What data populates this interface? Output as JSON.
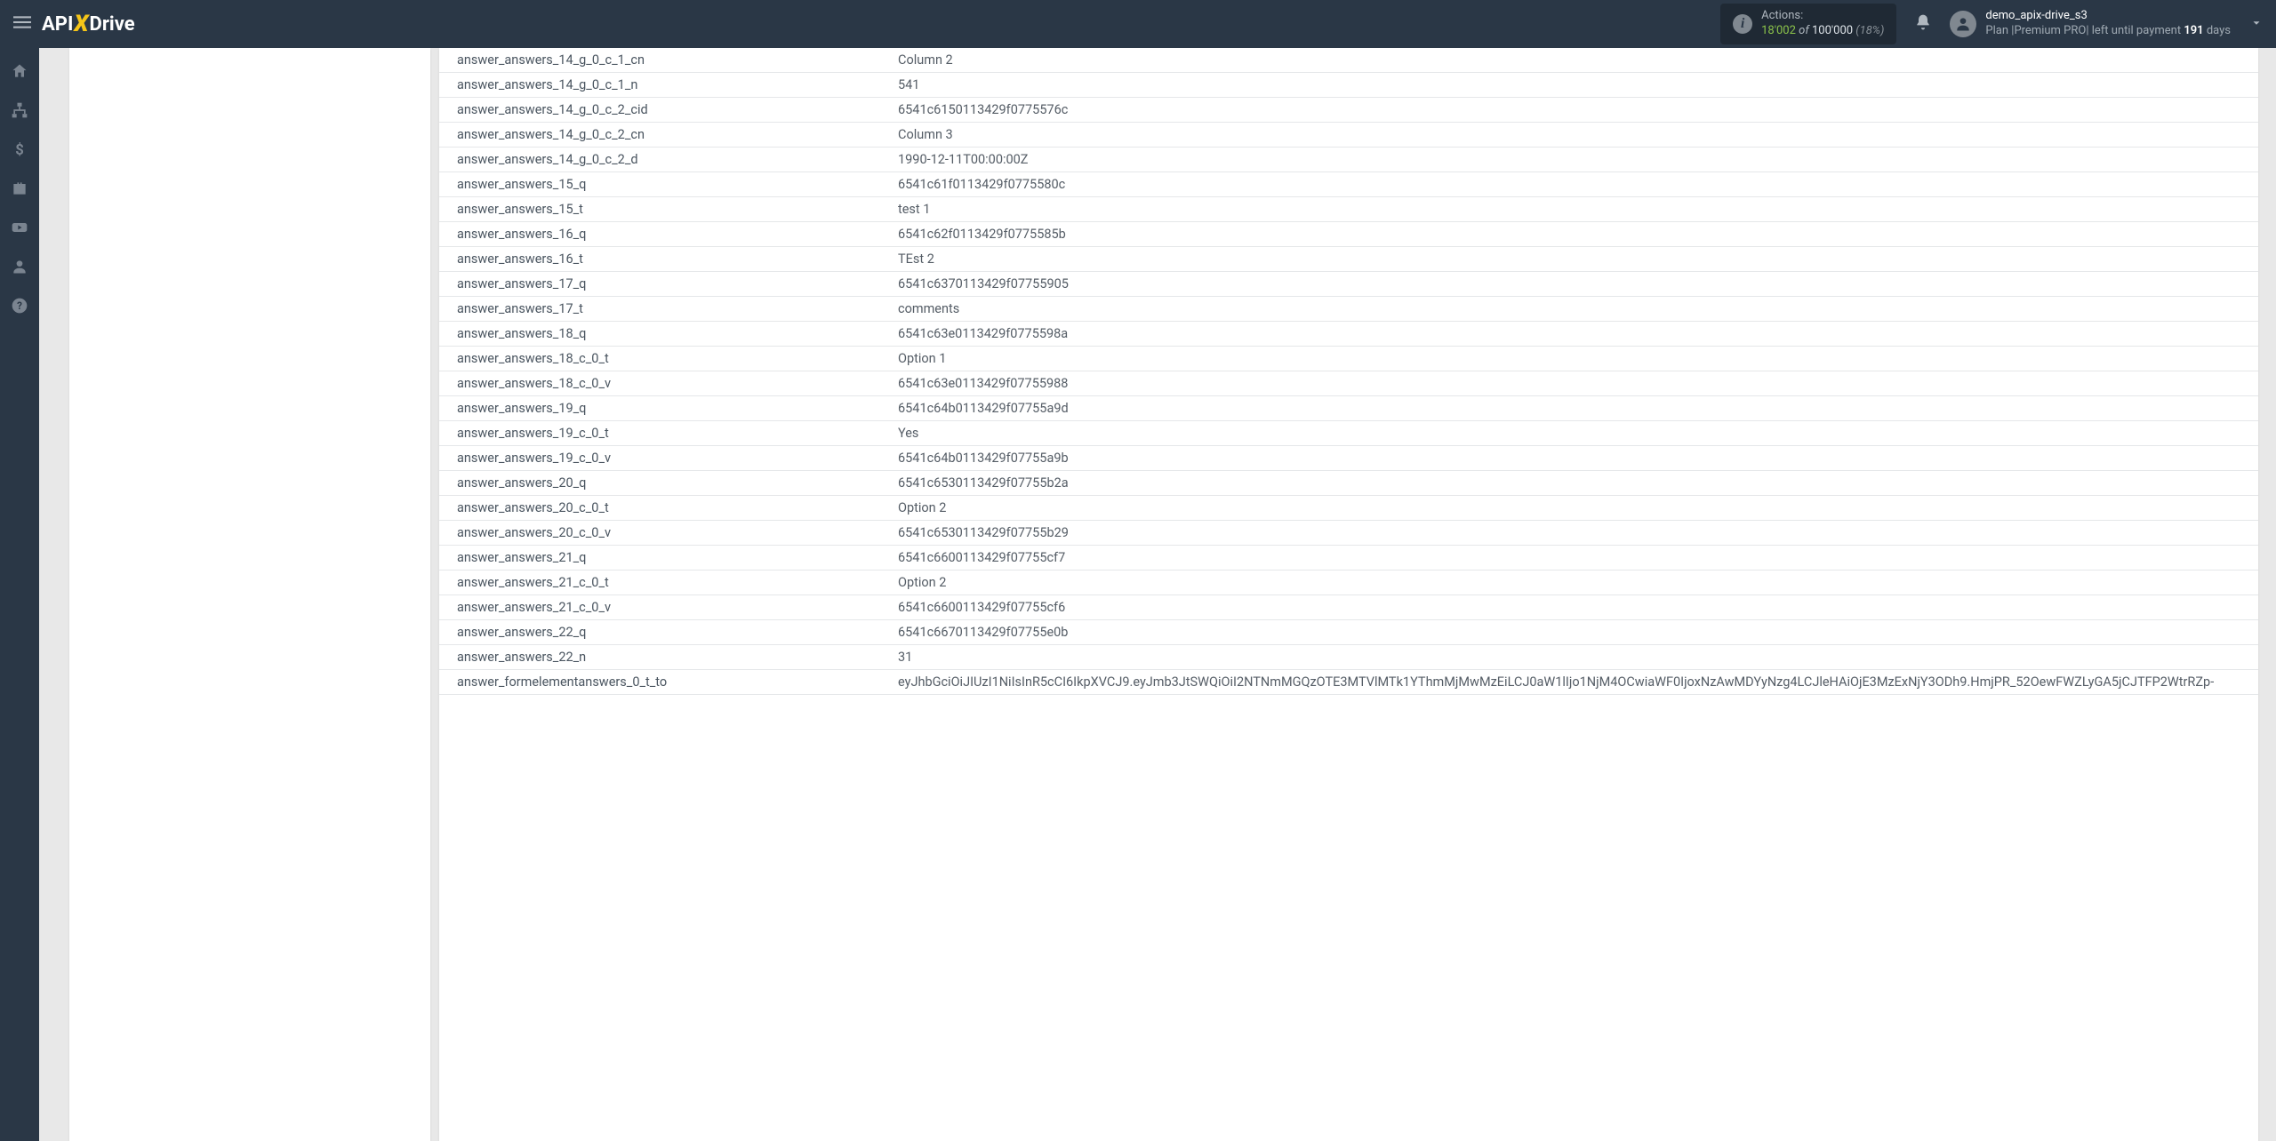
{
  "header": {
    "logo_api": "API",
    "logo_drive": "Drive",
    "actions_label": "Actions:",
    "actions_used": "18'002",
    "actions_of": "of",
    "actions_total": "100'000",
    "actions_pct": "(18%)",
    "user_name": "demo_apix-drive_s3",
    "plan_prefix": "Plan |",
    "plan_name": "Premium PRO",
    "plan_mid": "| left until payment ",
    "plan_days": "191",
    "plan_suffix": " days"
  },
  "rows": [
    {
      "k": "answer_answers_14_g_0_c_1_cn",
      "v": "Column 2"
    },
    {
      "k": "answer_answers_14_g_0_c_1_n",
      "v": "541"
    },
    {
      "k": "answer_answers_14_g_0_c_2_cid",
      "v": "6541c6150113429f0775576c"
    },
    {
      "k": "answer_answers_14_g_0_c_2_cn",
      "v": "Column 3"
    },
    {
      "k": "answer_answers_14_g_0_c_2_d",
      "v": "1990-12-11T00:00:00Z"
    },
    {
      "k": "answer_answers_15_q",
      "v": "6541c61f0113429f0775580c"
    },
    {
      "k": "answer_answers_15_t",
      "v": "test 1"
    },
    {
      "k": "answer_answers_16_q",
      "v": "6541c62f0113429f0775585b"
    },
    {
      "k": "answer_answers_16_t",
      "v": "TEst 2"
    },
    {
      "k": "answer_answers_17_q",
      "v": "6541c6370113429f07755905"
    },
    {
      "k": "answer_answers_17_t",
      "v": "comments"
    },
    {
      "k": "answer_answers_18_q",
      "v": "6541c63e0113429f0775598a"
    },
    {
      "k": "answer_answers_18_c_0_t",
      "v": "Option 1"
    },
    {
      "k": "answer_answers_18_c_0_v",
      "v": "6541c63e0113429f07755988"
    },
    {
      "k": "answer_answers_19_q",
      "v": "6541c64b0113429f07755a9d"
    },
    {
      "k": "answer_answers_19_c_0_t",
      "v": "Yes"
    },
    {
      "k": "answer_answers_19_c_0_v",
      "v": "6541c64b0113429f07755a9b"
    },
    {
      "k": "answer_answers_20_q",
      "v": "6541c6530113429f07755b2a"
    },
    {
      "k": "answer_answers_20_c_0_t",
      "v": "Option 2"
    },
    {
      "k": "answer_answers_20_c_0_v",
      "v": "6541c6530113429f07755b29"
    },
    {
      "k": "answer_answers_21_q",
      "v": "6541c6600113429f07755cf7"
    },
    {
      "k": "answer_answers_21_c_0_t",
      "v": "Option 2"
    },
    {
      "k": "answer_answers_21_c_0_v",
      "v": "6541c6600113429f07755cf6"
    },
    {
      "k": "answer_answers_22_q",
      "v": "6541c6670113429f07755e0b"
    },
    {
      "k": "answer_answers_22_n",
      "v": "31"
    },
    {
      "k": "answer_formelementanswers_0_t_to",
      "v": "eyJhbGciOiJIUzI1NiIsInR5cCI6IkpXVCJ9.eyJmb3JtSWQiOiI2NTNmMGQzOTE3MTVlMTk1YThmMjMwMzEiLCJ0aW1lIjo1NjM4OCwiaWF0IjoxNzAwMDYyNzg4LCJleHAiOjE3MzExNjY3ODh9.HmjPR_52OewFWZLyGA5jCJTFP2WtrRZp-"
    }
  ]
}
